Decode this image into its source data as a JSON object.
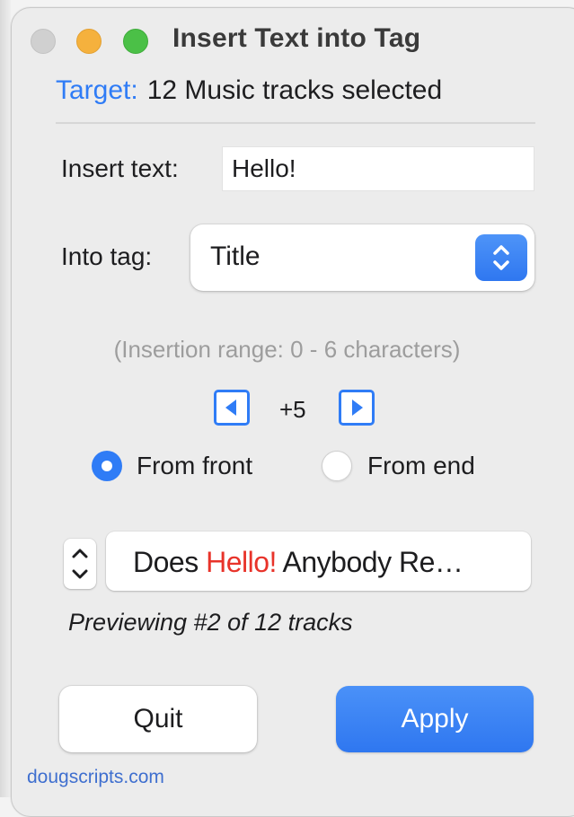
{
  "window": {
    "title": "Insert Text into Tag"
  },
  "target": {
    "label": "Target:",
    "value": "12 Music tracks selected"
  },
  "insert": {
    "label": "Insert text:",
    "value": "Hello!"
  },
  "tag": {
    "label": "Into tag:",
    "selected": "Title"
  },
  "range_note": "(Insertion range: 0 - 6 characters)",
  "offset": {
    "value": "+5"
  },
  "position": {
    "from_front_label": "From front",
    "from_end_label": "From end",
    "selected": "From front"
  },
  "preview": {
    "before": "Does ",
    "inserted": "Hello!",
    "after": " Anybody Re…",
    "note": "Previewing #2 of 12 tracks"
  },
  "buttons": {
    "quit": "Quit",
    "apply": "Apply"
  },
  "footer": {
    "link": "dougscripts.com"
  },
  "colors": {
    "accent": "#2f7cf6",
    "insert_highlight": "#e8332a"
  },
  "icons": [
    "close-icon",
    "minimize-icon",
    "maximize-icon",
    "popup-chevrons-icon",
    "left-arrow-icon",
    "right-arrow-icon",
    "stepper-chevrons-icon"
  ]
}
